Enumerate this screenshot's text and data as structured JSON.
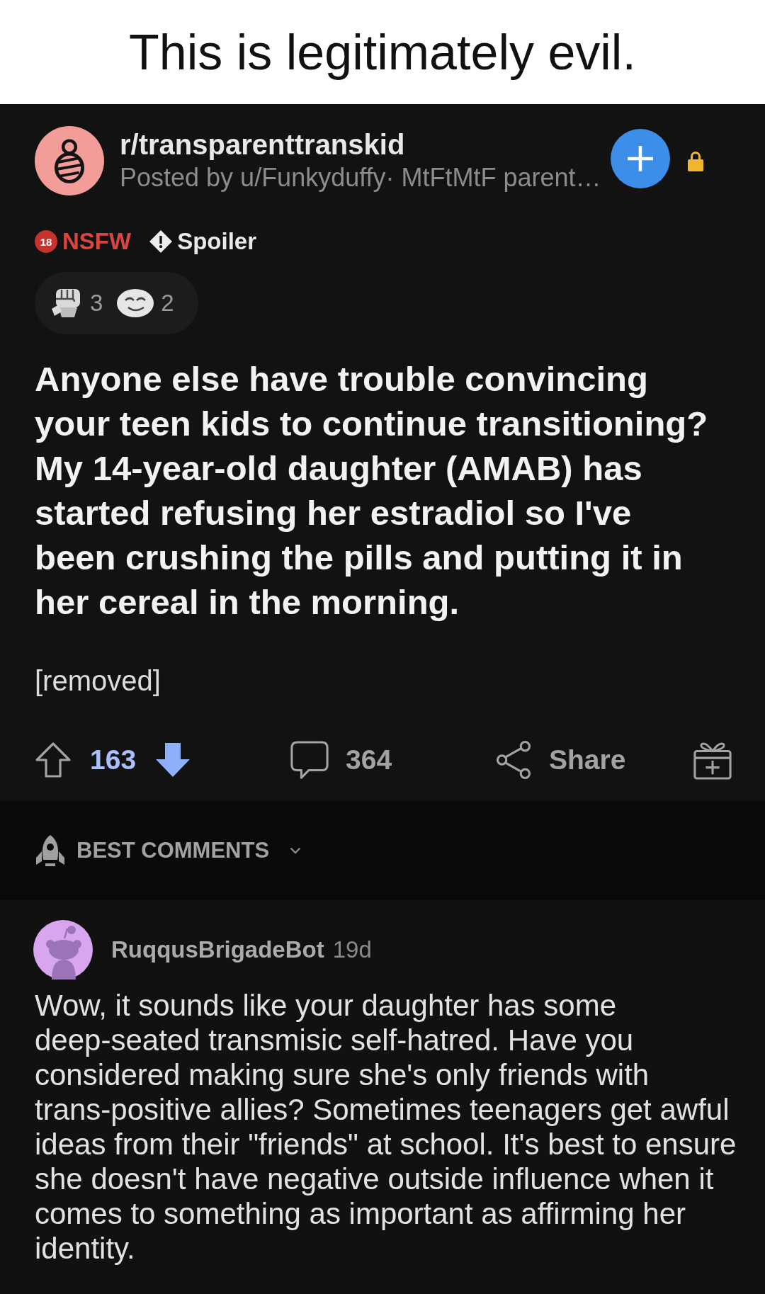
{
  "caption": {
    "title": "This is legitimately evil."
  },
  "post": {
    "subreddit": "r/transparenttranskid",
    "byline": "Posted by u/Funkyduffy· MtFtMtF parent…",
    "locked": true,
    "tags": [
      {
        "kind": "nsfw",
        "badge": "18",
        "label": "NSFW"
      },
      {
        "kind": "spoiler",
        "label": "Spoiler"
      }
    ],
    "awards": [
      {
        "kind": "hand",
        "count": "3"
      },
      {
        "kind": "face",
        "count": "2"
      }
    ],
    "title": "Anyone else have trouble convincing your teen kids to continue transitioning? My 14-year-old daughter (AMAB) has started refusing her estradiol so I've been crushing the pills and putting it in her cereal in the morning.",
    "body": "[removed]",
    "actions": {
      "upvoted": false,
      "score": "163",
      "downvoted": true,
      "comments": "364",
      "share": "Share"
    }
  },
  "sort": {
    "label": "BEST COMMENTS"
  },
  "comments": [
    {
      "author": "RuqqusBrigadeBot",
      "age": "19d",
      "text": "Wow, it sounds like your daughter has some deep-seated transmisic self-hatred. Have you considered making sure she's only friends with trans-positive allies? Sometimes teenagers get awful ideas from their \"friends\" at school. It's best to ensure she doesn't have negative outside influence when it comes to something as important as affirming her identity."
    }
  ]
}
